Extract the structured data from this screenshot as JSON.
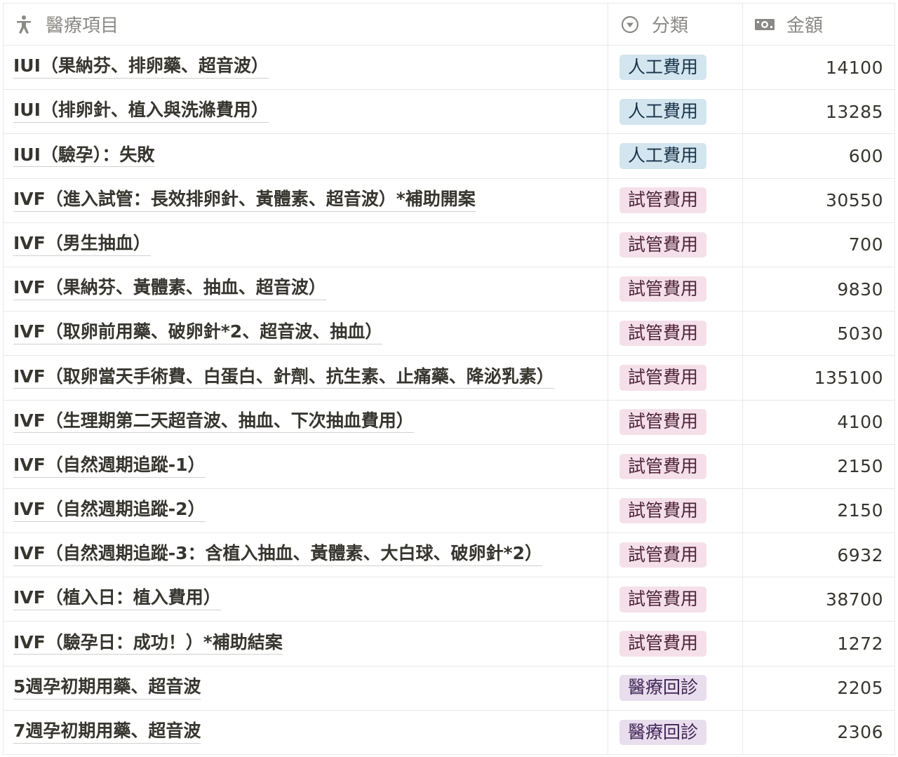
{
  "header": {
    "col_item": "醫療項目",
    "col_category": "分類",
    "col_amount": "金額",
    "icons": [
      "person-icon",
      "select-icon",
      "money-icon"
    ]
  },
  "colors": {
    "blue_tag": "#d3e5ef",
    "pink_tag": "#f5e0e9",
    "purple_tag": "#e8deee"
  },
  "rows": [
    {
      "name": "IUI（果納芬、排卵藥、超音波）",
      "category": "人工費用",
      "color": "blue",
      "amount": "14100"
    },
    {
      "name": "IUI（排卵針、植入與洗滌費用）",
      "category": "人工費用",
      "color": "blue",
      "amount": "13285"
    },
    {
      "name": "IUI（驗孕）：失敗",
      "category": "人工費用",
      "color": "blue",
      "amount": "600"
    },
    {
      "name": "IVF（進入試管：長效排卵針、黃體素、超音波）*補助開案",
      "category": "試管費用",
      "color": "pink",
      "amount": "30550"
    },
    {
      "name": "IVF（男生抽血）",
      "category": "試管費用",
      "color": "pink",
      "amount": "700"
    },
    {
      "name": "IVF（果納芬、黃體素、抽血、超音波）",
      "category": "試管費用",
      "color": "pink",
      "amount": "9830"
    },
    {
      "name": "IVF（取卵前用藥、破卵針*2、超音波、抽血）",
      "category": "試管費用",
      "color": "pink",
      "amount": "5030"
    },
    {
      "name": "IVF（取卵當天手術費、白蛋白、針劑、抗生素、止痛藥、降泌乳素）",
      "category": "試管費用",
      "color": "pink",
      "amount": "135100"
    },
    {
      "name": "IVF（生理期第二天超音波、抽血、下次抽血費用）",
      "category": "試管費用",
      "color": "pink",
      "amount": "4100"
    },
    {
      "name": "IVF（自然週期追蹤-1）",
      "category": "試管費用",
      "color": "pink",
      "amount": "2150"
    },
    {
      "name": "IVF（自然週期追蹤-2）",
      "category": "試管費用",
      "color": "pink",
      "amount": "2150"
    },
    {
      "name": "IVF（自然週期追蹤-3：含植入抽血、黃體素、大白球、破卵針*2）",
      "category": "試管費用",
      "color": "pink",
      "amount": "6932"
    },
    {
      "name": "IVF（植入日：植入費用）",
      "category": "試管費用",
      "color": "pink",
      "amount": "38700"
    },
    {
      "name": "IVF（驗孕日：成功！）*補助結案",
      "category": "試管費用",
      "color": "pink",
      "amount": "1272"
    },
    {
      "name": "5週孕初期用藥、超音波",
      "category": "醫療回診",
      "color": "purple",
      "amount": "2205"
    },
    {
      "name": "7週孕初期用藥、超音波",
      "category": "醫療回診",
      "color": "purple",
      "amount": "2306"
    }
  ]
}
